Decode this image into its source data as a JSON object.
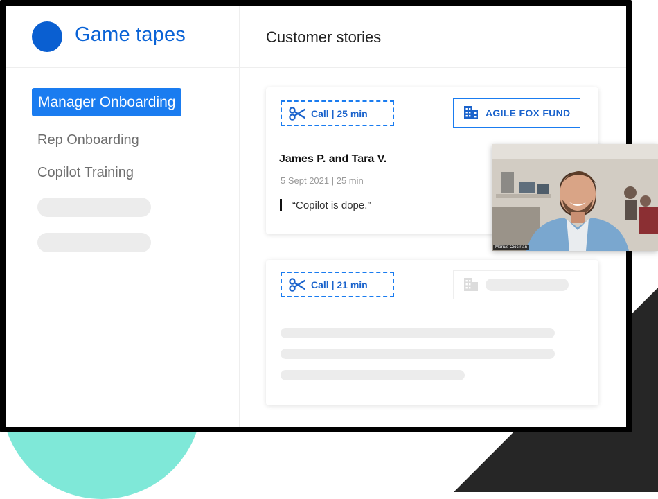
{
  "sidebar": {
    "app_title": "Game tapes",
    "items": [
      {
        "label": "Manager Onboarding",
        "active": true
      },
      {
        "label": "Rep Onboarding",
        "active": false
      },
      {
        "label": "Copilot Training",
        "active": false
      }
    ]
  },
  "main": {
    "header_title": "Customer stories",
    "cards": [
      {
        "call_label": "Call | 25 min",
        "company": "AGILE FOX FUND",
        "participants": "James P. and Tara V.",
        "meta": "5 Sept 2021 | 25 min",
        "quote": "“Copilot is dope.”"
      },
      {
        "call_label": "Call | 21 min"
      }
    ]
  },
  "video_tile": {
    "caption": "Marius Ciocirlan"
  },
  "colors": {
    "brand_blue": "#0a63d6",
    "accent_blue": "#1a7cf0",
    "teal": "#7fe8d8",
    "dark": "#262626"
  },
  "icons": {
    "logo": "circle-logo-icon",
    "call": "scissors-icon",
    "company": "building-icon"
  }
}
